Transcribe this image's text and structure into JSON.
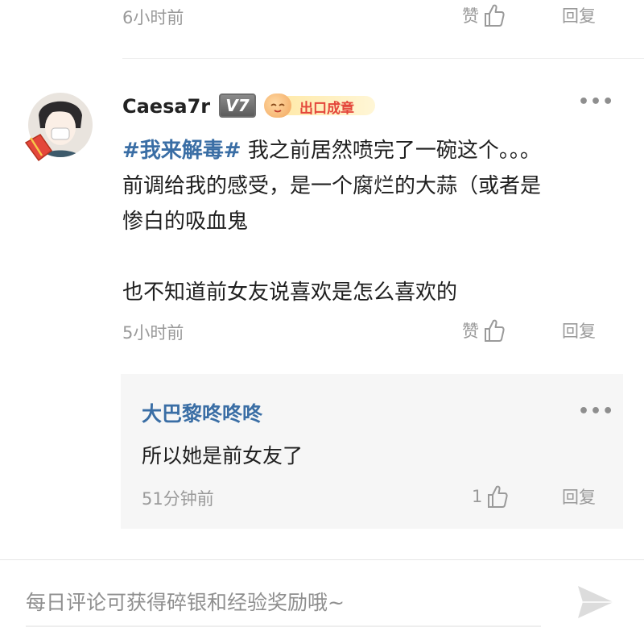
{
  "top_comment": {
    "time": "6小时前",
    "like_label": "赞",
    "reply_label": "回复"
  },
  "comment": {
    "username": "Caesa7r",
    "level_badge": "V7",
    "medal_text": "出口成章",
    "topic": "#我来解毒#",
    "lines": [
      " 我之前居然喷完了一碗这个。。。",
      "前调给我的感受，是一个腐烂的大蒜（或者是",
      "惨白的吸血鬼",
      "",
      "也不知道前女友说喜欢是怎么喜欢的"
    ],
    "time": "5小时前",
    "like_label": "赞",
    "reply_label": "回复"
  },
  "reply": {
    "username": "大巴黎咚咚咚",
    "text": "所以她是前女友了",
    "time": "51分钟前",
    "like_count": "1",
    "reply_label": "回复"
  },
  "input": {
    "placeholder": "每日评论可获得碎银和经验奖励哦~"
  },
  "colors": {
    "link_blue": "#3a6ea5",
    "muted_gray": "#9a9a9a",
    "medal_red": "#e4473b",
    "medal_gold": "#f6c84a"
  }
}
